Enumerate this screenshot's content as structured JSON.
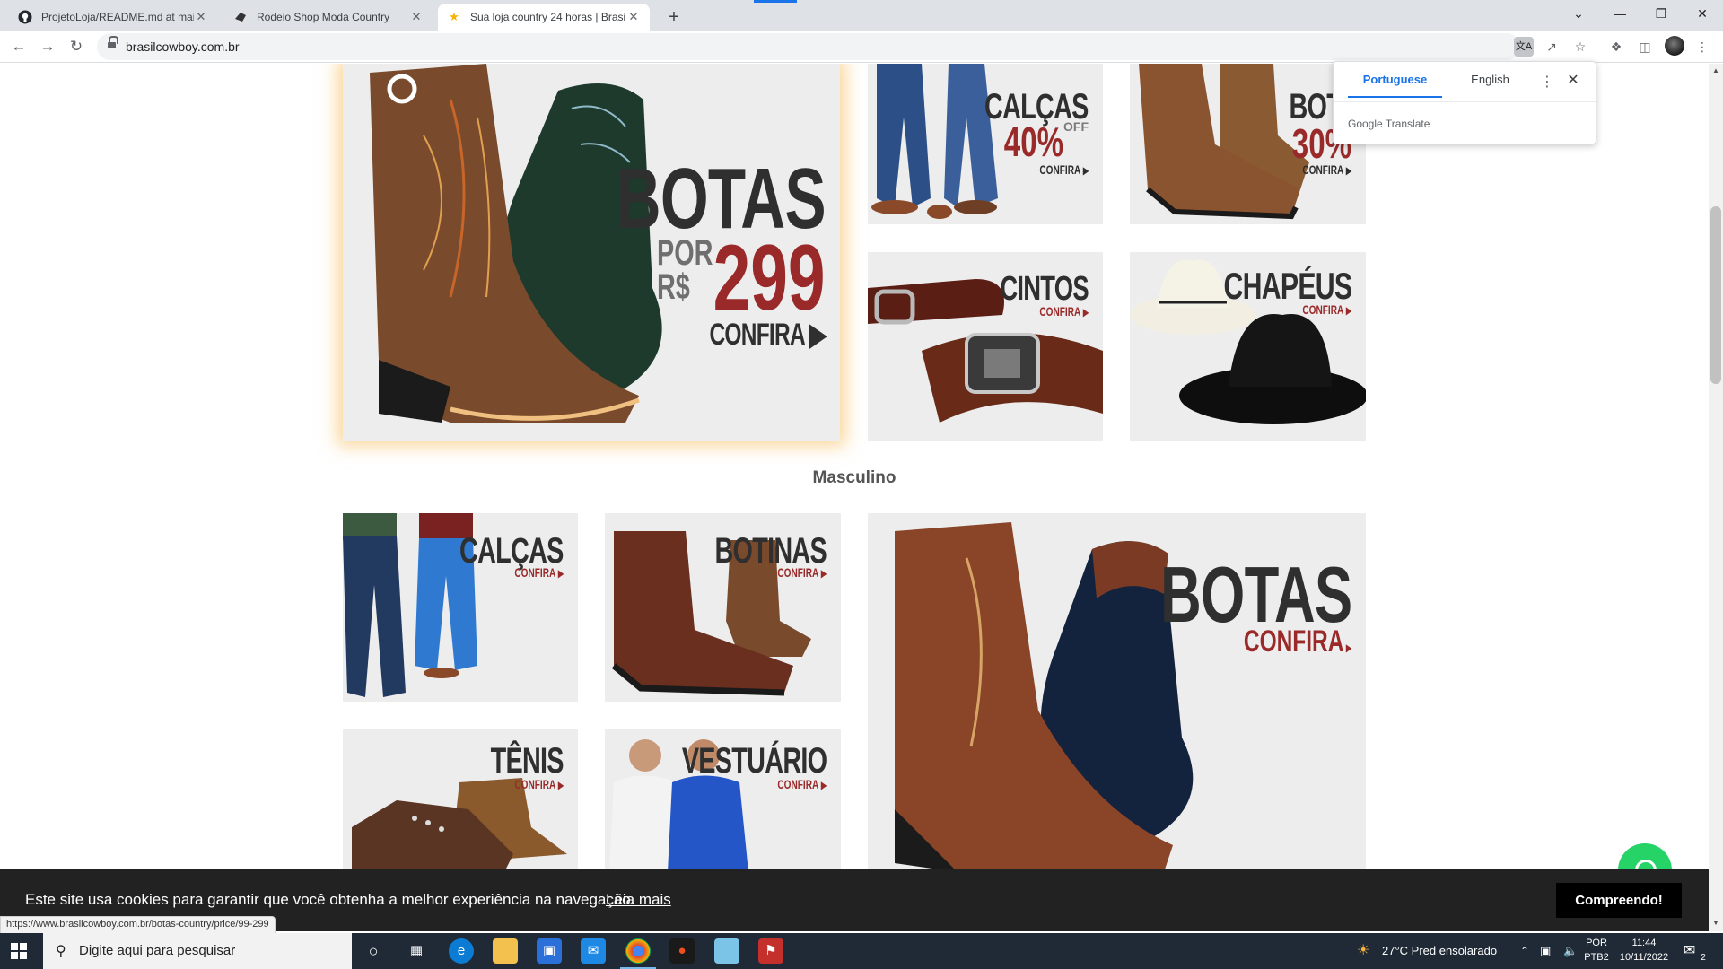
{
  "browser": {
    "tabs": [
      {
        "title": "ProjetoLoja/README.md at main",
        "icon": "github-icon"
      },
      {
        "title": "Rodeio Shop Moda Country",
        "icon": "rodeo-icon"
      },
      {
        "title": "Sua loja country 24 horas | Brasil",
        "icon": "star-icon"
      }
    ],
    "close_glyph": "✕",
    "new_tab_glyph": "+",
    "url": "brasilcowboy.com.br",
    "window_controls": {
      "dropdown": "⌄",
      "minimize": "—",
      "restore": "❐",
      "close": "✕"
    }
  },
  "translate_popup": {
    "tabs": [
      "Portuguese",
      "English"
    ],
    "active_tab": "Portuguese",
    "brand": "Google Translate",
    "menu_glyph": "⋮",
    "close_glyph": "✕"
  },
  "page": {
    "banners_top": {
      "botas_promo": {
        "title": "BOTAS",
        "por": "POR",
        "currency": "R$",
        "price": "299",
        "cta": "CONFIRA"
      },
      "calcas": {
        "title": "CALÇAS",
        "pct": "40%",
        "off": "OFF",
        "cta": "CONFIRA"
      },
      "botinas": {
        "title": "BOTIN",
        "pct": "30%",
        "cta": "CONFIRA"
      },
      "cintos": {
        "title": "CINTOS",
        "cta": "CONFIRA"
      },
      "chapeus": {
        "title": "CHAPÉUS",
        "cta": "CONFIRA"
      }
    },
    "section_title": "Masculino",
    "banners_masculino": {
      "calcas": {
        "title": "CALÇAS",
        "cta": "CONFIRA"
      },
      "botinas": {
        "title": "BOTINAS",
        "cta": "CONFIRA"
      },
      "botas": {
        "title": "BOTAS",
        "cta": "CONFIRA"
      },
      "tenis": {
        "title": "TÊNIS",
        "cta": "CONFIRA"
      },
      "vestuario": {
        "title": "VESTUÁRIO",
        "cta": "CONFIRA"
      }
    },
    "cookie": {
      "text": "Este site usa cookies para garantir que você obtenha a melhor experiência na navegação.",
      "link": "Leia mais",
      "button": "Compreendo!"
    },
    "status_url": "https://www.brasilcowboy.com.br/botas-country/price/99-299"
  },
  "taskbar": {
    "search_placeholder": "Digite aqui para pesquisar",
    "weather": "27°C  Pred ensolarado",
    "lang_top": "POR",
    "lang_bottom": "PTB2",
    "time": "11:44",
    "date": "10/11/2022",
    "notifications": "2"
  },
  "colors": {
    "accent_red": "#9a2a2a",
    "chrome_blue": "#1a73e8",
    "whatsapp_green": "#25d366",
    "taskbar": "#1f2a36"
  }
}
